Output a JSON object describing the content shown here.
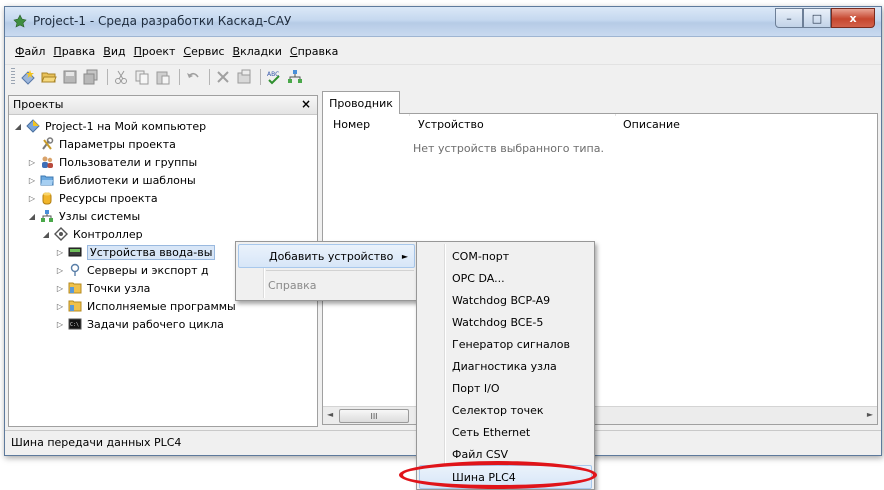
{
  "window": {
    "title": "Project-1 - Среда разработки Каскад-САУ",
    "buttons": {
      "minimize": "–",
      "maximize": "□",
      "close": "x"
    }
  },
  "menu": [
    {
      "u": "Ф",
      "rest": "айл"
    },
    {
      "u": "П",
      "rest": "равка"
    },
    {
      "u": "В",
      "rest": "ид"
    },
    {
      "u": "П",
      "rest": "роект"
    },
    {
      "u": "С",
      "rest": "ервис"
    },
    {
      "u": "В",
      "rest": "кладки"
    },
    {
      "u": "С",
      "rest": "правка"
    }
  ],
  "left_panel": {
    "title": "Проекты",
    "close": "×",
    "tree": [
      "Project-1 на Мой компьютер",
      "Параметры проекта",
      "Пользователи и группы",
      "Библиотеки и шаблоны",
      "Ресурсы проекта",
      "Узлы системы",
      "Контроллер",
      "Устройства ввода-вы",
      "Серверы и экспорт д",
      "Точки узла",
      "Исполняемые программы",
      "Задачи рабочего цикла"
    ]
  },
  "right_panel": {
    "tab": "Проводник",
    "columns": [
      "Номер",
      "Устройство",
      "Описание"
    ],
    "empty_message": "Нет устройств выбранного типа.",
    "scroll_thumb": "III",
    "left_arrow": "◄",
    "right_arrow": "►"
  },
  "context_menu": {
    "add_device": "Добавить устройство",
    "help": "Справка",
    "submenu_arrow": "►"
  },
  "submenu": [
    "COM-порт",
    "OPC DA...",
    "Watchdog BCP-A9",
    "Watchdog BCE-5",
    "Генератор сигналов",
    "Диагностика узла",
    "Порт I/O",
    "Селектор точек",
    "Сеть Ethernet",
    "Файл CSV",
    "Шина PLC4"
  ],
  "status": "Шина передачи данных PLC4",
  "colors": {
    "highlight_ellipse": "#e0141a",
    "selection": "#d8e6f7",
    "menu_highlight": "#d7e6f8"
  }
}
